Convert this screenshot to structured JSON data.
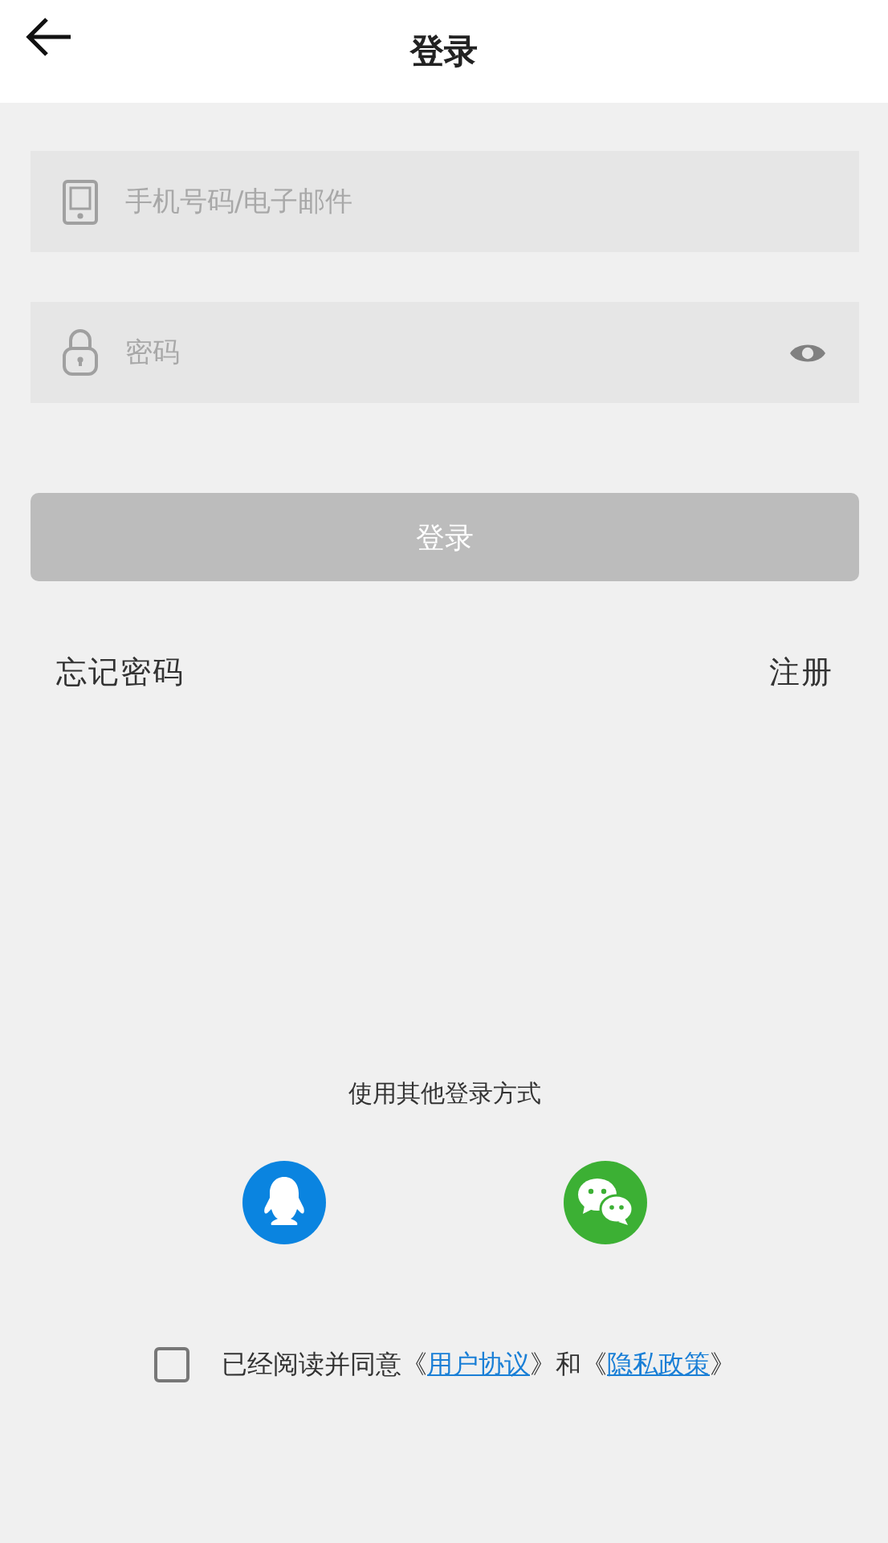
{
  "header": {
    "title": "登录"
  },
  "fields": [
    {
      "kind": "phone",
      "placeholder": "手机号码/电子邮件"
    },
    {
      "kind": "password",
      "placeholder": "密码",
      "reveal_toggle": true
    }
  ],
  "login_button": {
    "label": "登录",
    "disabled": true
  },
  "links": {
    "forgot": "忘记密码",
    "register": "注册"
  },
  "other_login": {
    "label": "使用其他登录方式",
    "providers": [
      {
        "kind": "qq",
        "color": "#0a84e0"
      },
      {
        "kind": "wechat",
        "color": "#3cb034"
      }
    ]
  },
  "agreement": {
    "checked": false,
    "parts": [
      {
        "kind": "text",
        "text": "已经阅读并同意《"
      },
      {
        "kind": "link",
        "text": "用户协议"
      },
      {
        "kind": "text",
        "text": "》和《"
      },
      {
        "kind": "link",
        "text": "隐私政策"
      },
      {
        "kind": "text",
        "text": "》"
      }
    ]
  }
}
